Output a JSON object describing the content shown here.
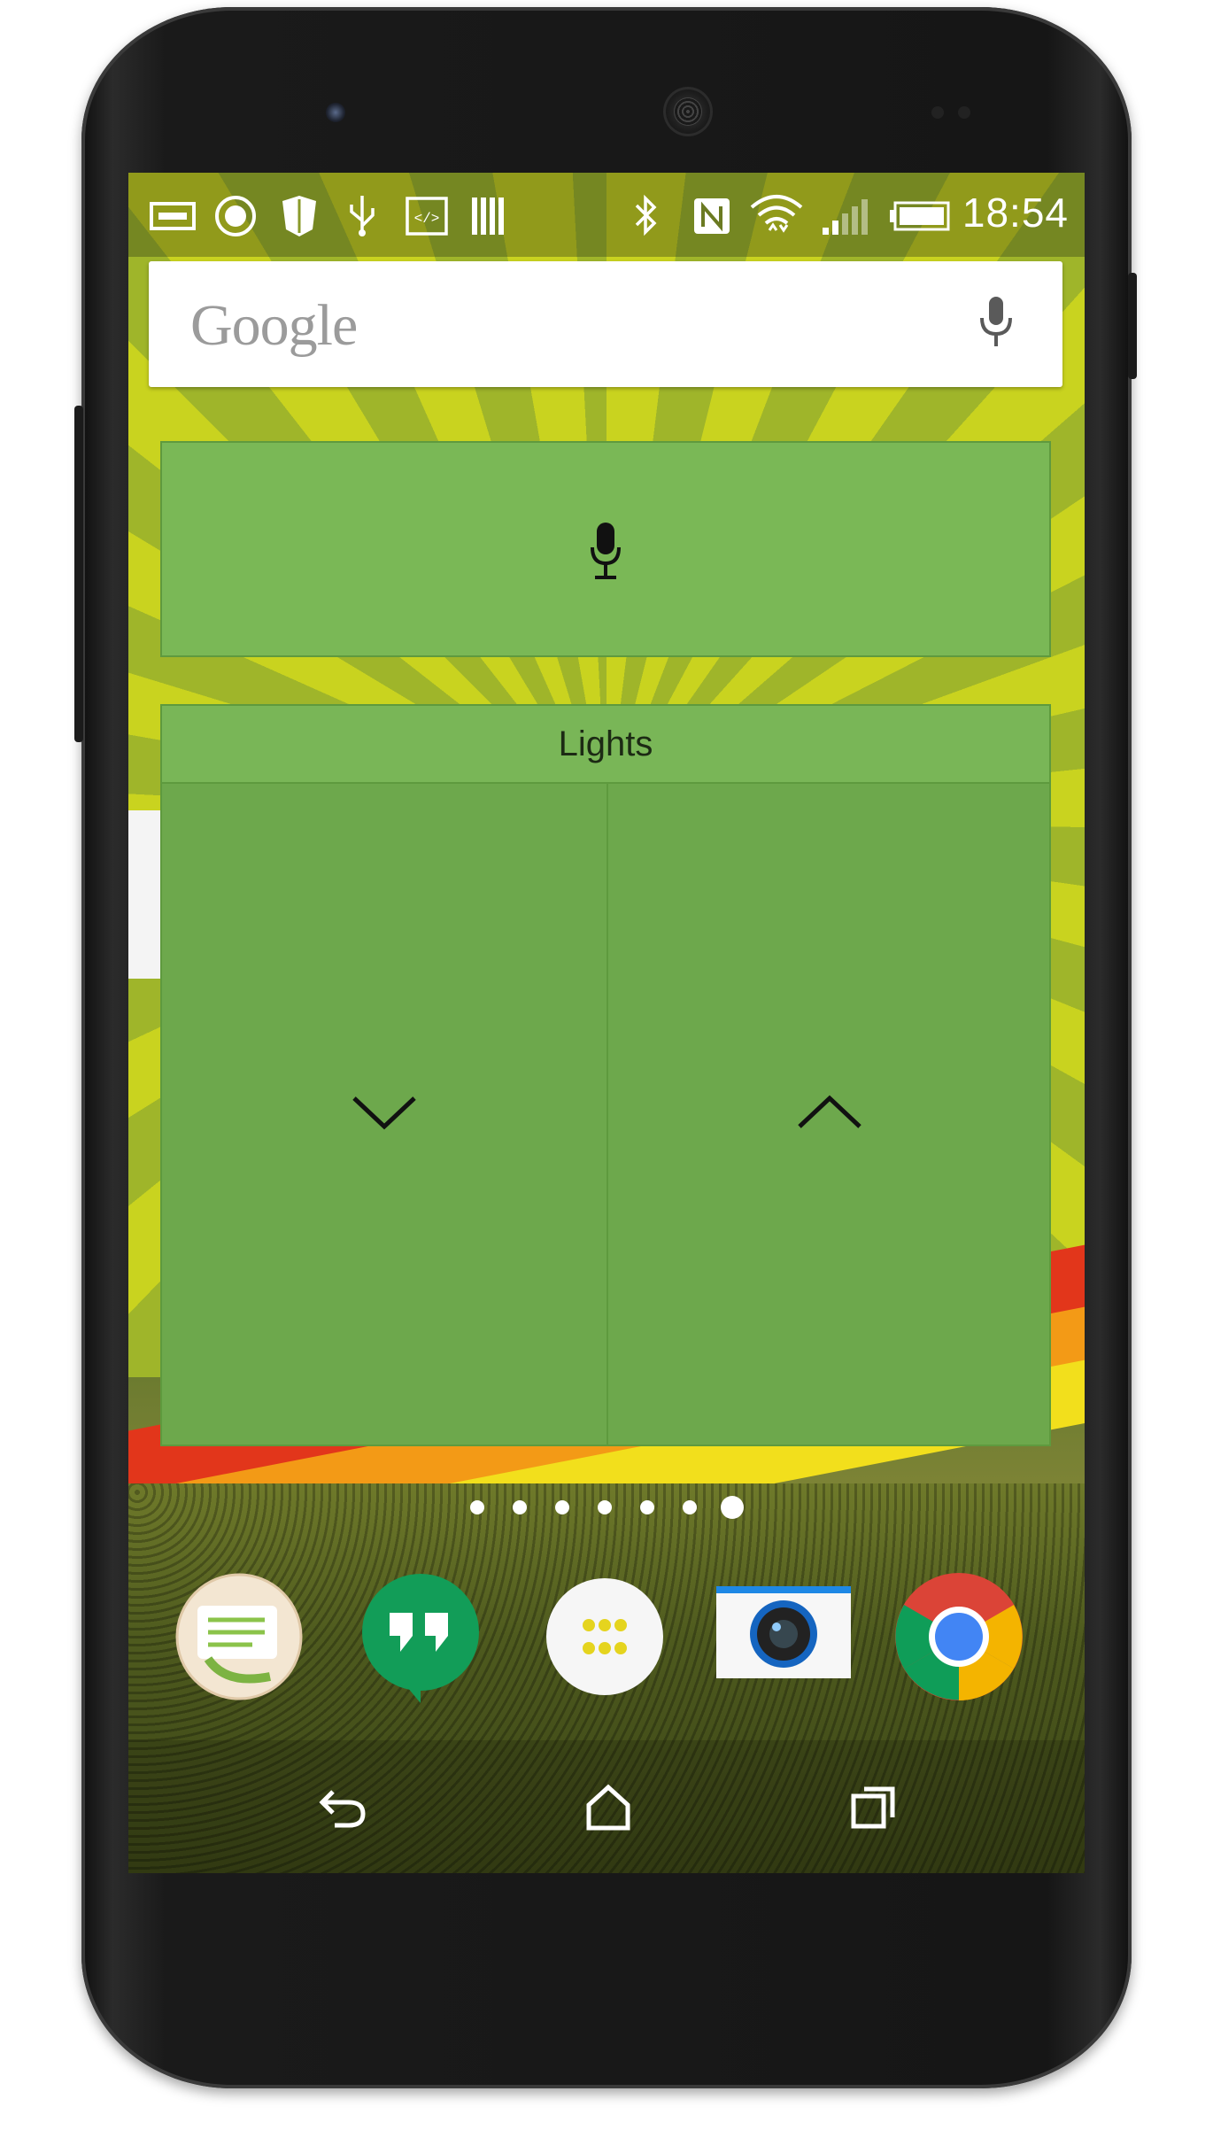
{
  "status_bar": {
    "time": "18:54",
    "left_icons": [
      "keyboard-icon",
      "sync-icon",
      "shield-icon",
      "usb-icon",
      "code-icon",
      "barcode-icon"
    ],
    "right_icons": [
      "bluetooth-icon",
      "nfc-icon",
      "wifi-icon",
      "signal-icon",
      "battery-icon"
    ]
  },
  "search_widget": {
    "logo_text": "Google",
    "mic_icon": "microphone-icon"
  },
  "voice_widget": {
    "icon": "microphone-icon"
  },
  "lights_widget": {
    "title": "Lights",
    "down_icon": "chevron-down-icon",
    "up_icon": "chevron-up-icon"
  },
  "home_pages": {
    "count": 7,
    "active_index": 6
  },
  "dock": {
    "apps": [
      {
        "icon": "contacts-dialer-icon"
      },
      {
        "icon": "hangouts-icon"
      },
      {
        "icon": "app-drawer-icon"
      },
      {
        "icon": "camera-icon"
      },
      {
        "icon": "chrome-icon"
      }
    ]
  },
  "nav_bar": {
    "back_icon": "back-icon",
    "home_icon": "home-icon",
    "recents_icon": "recents-icon"
  },
  "colors": {
    "widget_green": "#7ab856",
    "lights_green": "#6da84c",
    "search_bg": "#ffffff"
  }
}
